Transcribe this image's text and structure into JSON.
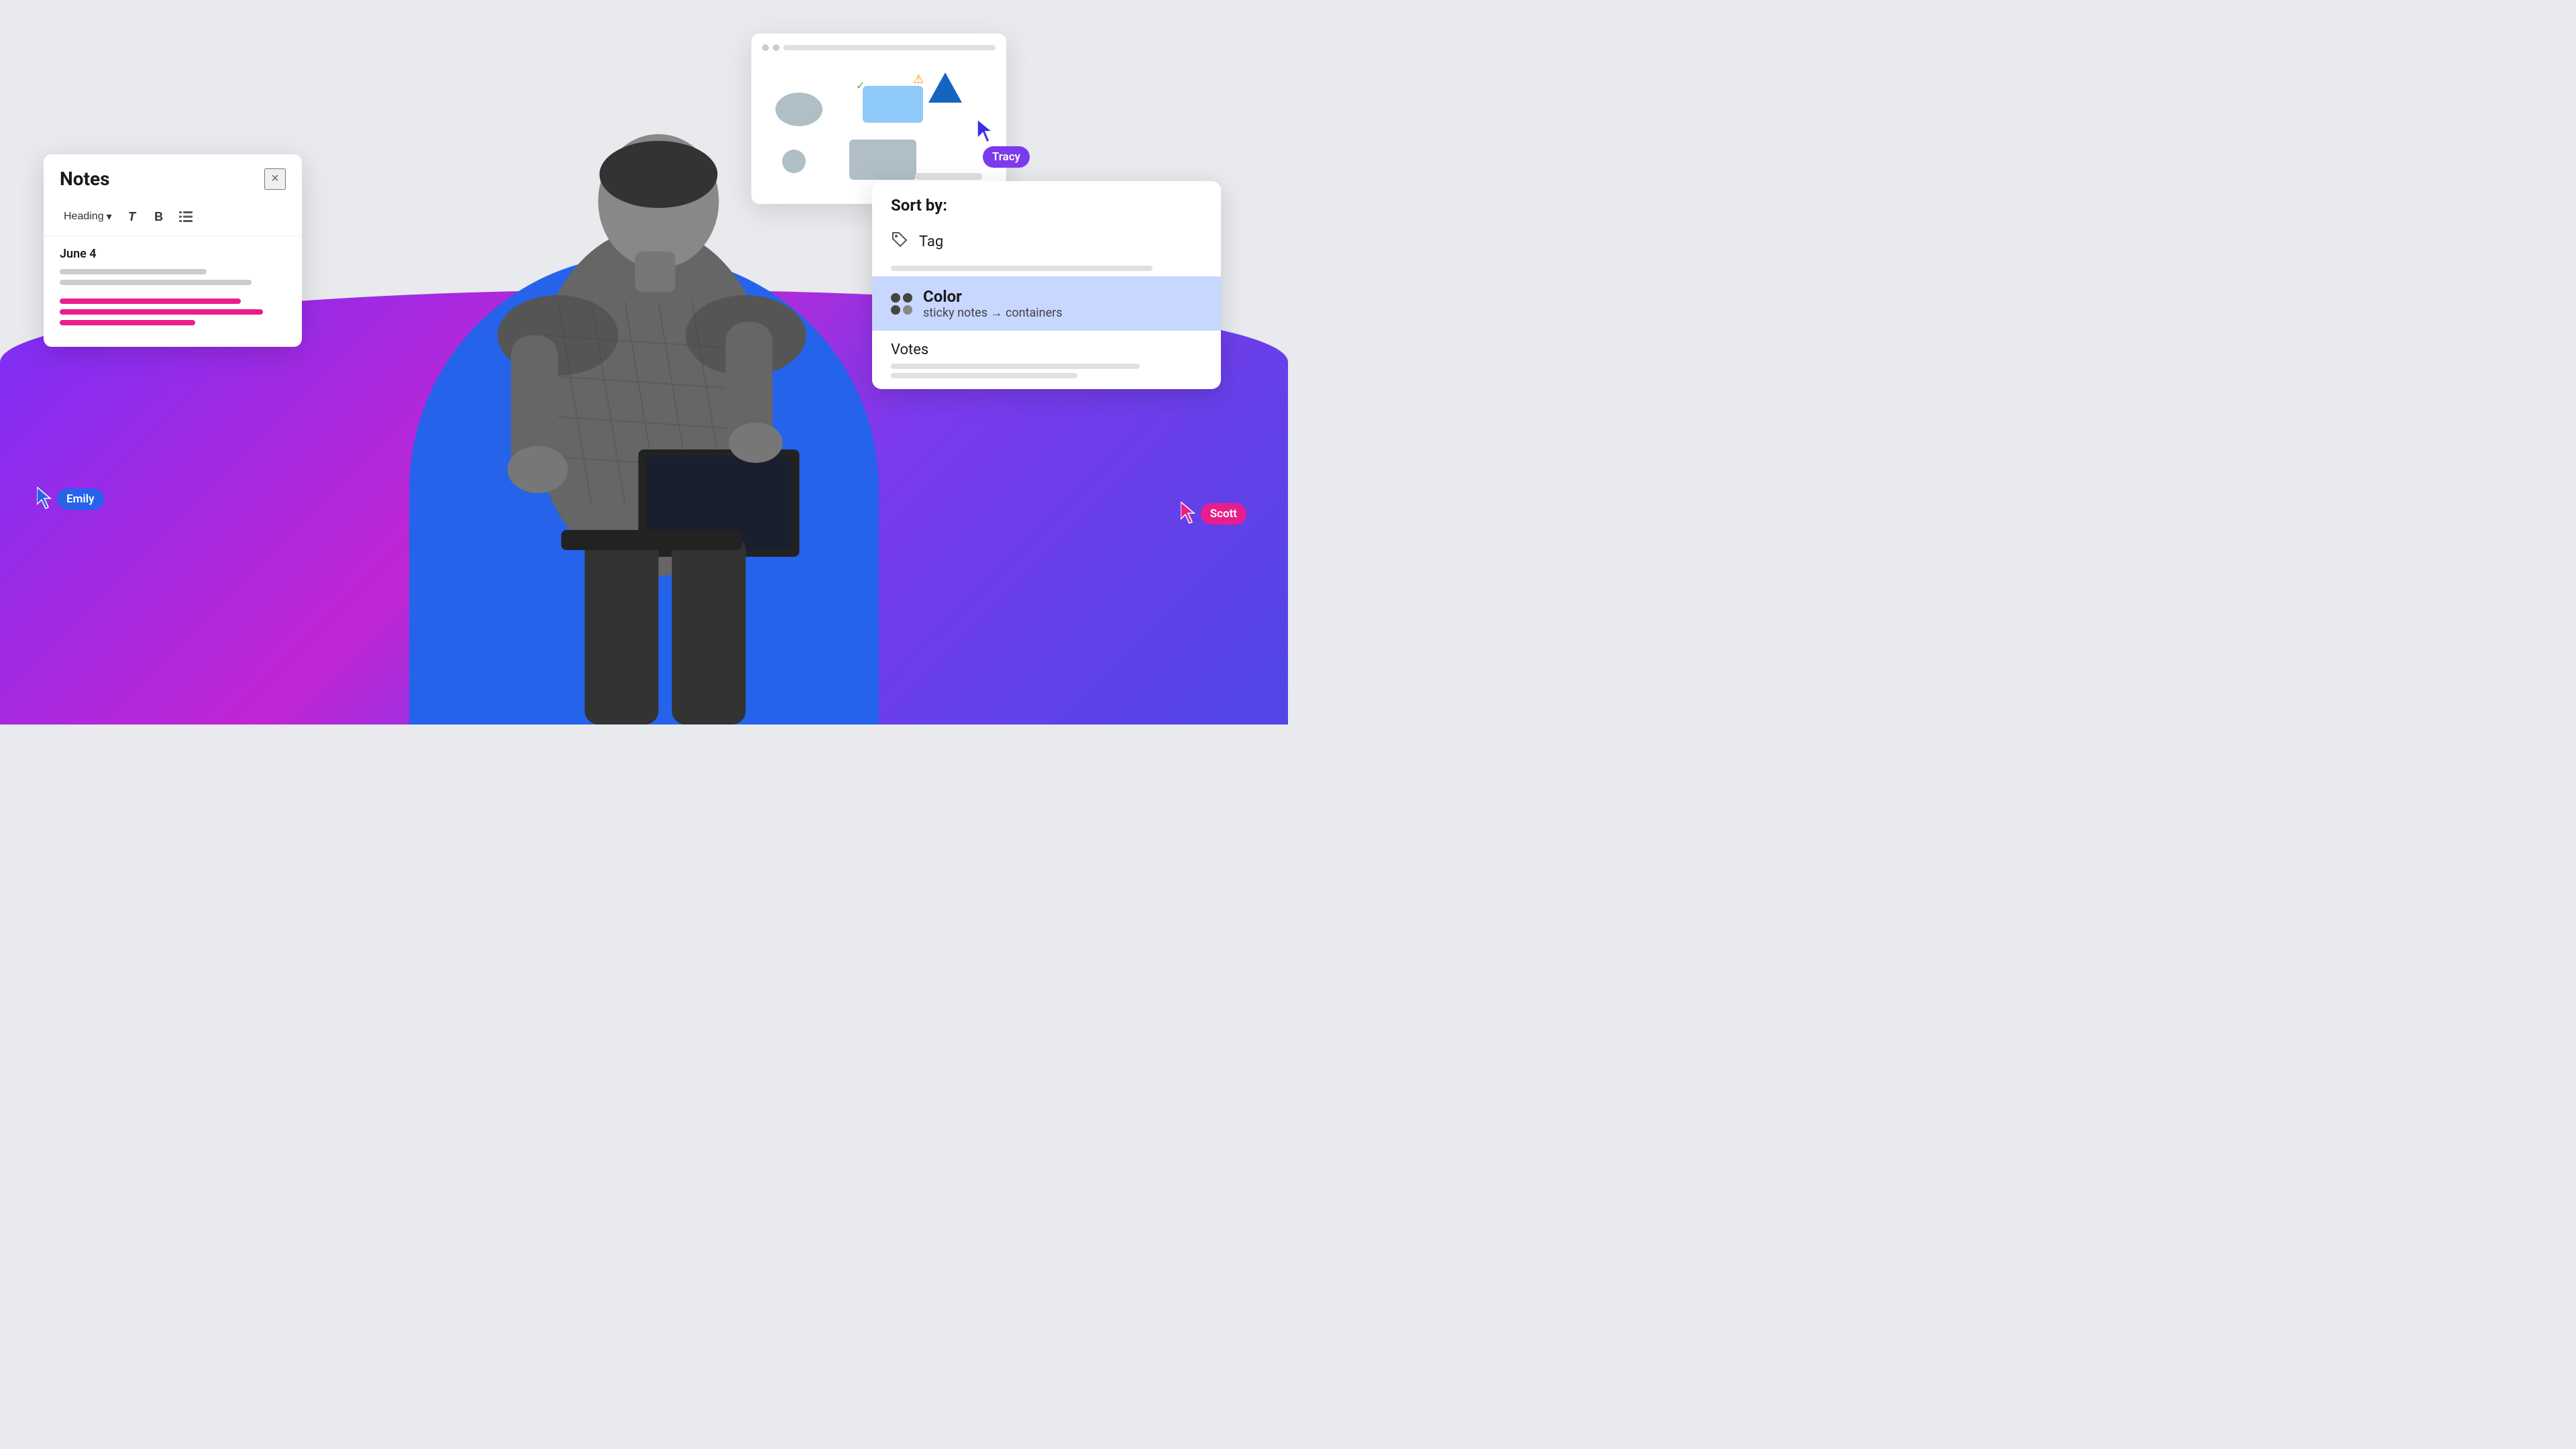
{
  "background": {
    "base_color": "#e8eaed",
    "gradient_colors": [
      "#7b2ff7",
      "#c026d3",
      "#7c3aed",
      "#4f46e5"
    ]
  },
  "notes_panel": {
    "title": "Notes",
    "close_label": "×",
    "toolbar": {
      "heading_label": "Heading",
      "dropdown_arrow": "▾",
      "bold_label": "B",
      "italic_label": "T",
      "list_label": "☰"
    },
    "date": "June 4"
  },
  "sort_panel": {
    "header": "Sort by:",
    "items": [
      {
        "id": "tag",
        "icon": "tag",
        "label": "Tag"
      },
      {
        "id": "color",
        "icon": "circles",
        "label": "Color",
        "sublabel": "sticky notes → containers",
        "highlighted": true
      },
      {
        "id": "votes",
        "icon": null,
        "label": "Votes"
      }
    ]
  },
  "users": {
    "tracy": {
      "name": "Tracy",
      "badge_color": "#7c3aed"
    },
    "emily": {
      "name": "Emily",
      "badge_color": "#2563eb"
    },
    "scott": {
      "name": "Scott",
      "badge_color": "#e91e8c"
    }
  },
  "tooltip": {
    "text": "Color sticky notes containers"
  }
}
